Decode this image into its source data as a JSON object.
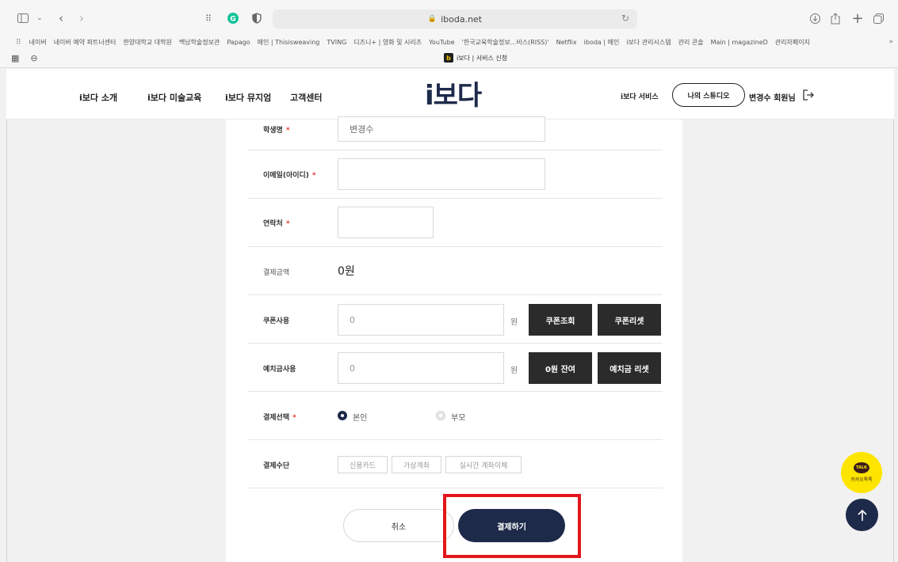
{
  "browser": {
    "url": "iboda.net",
    "bookmarks": [
      "네이버",
      "네이버 예약 파트너센터",
      "한양대학교 대학원",
      "백남학술정보관",
      "Papago",
      "메인 | Thisisweaving",
      "TVING",
      "디즈니+ | 영화 및 시리즈",
      "YouTube",
      "'한국교육학술정보...비스(RISS)'",
      "Netflix",
      "iboda | 메인",
      "i보다 관리시스템",
      "관리 콘솔",
      "Main | magazineD",
      "관리자페이지"
    ],
    "tab_title": "i보다 | 서비스 신청"
  },
  "header": {
    "nav": [
      "i보다 소개",
      "i보다 미술교육",
      "i보다 뮤지엄",
      "고객센터"
    ],
    "logo": "i보다",
    "service_link": "i보다 서비스",
    "studio_button": "나의 스튜디오",
    "member_name": "변경수 회원님"
  },
  "form": {
    "student_name": {
      "label": "학생명",
      "value": "변경수"
    },
    "email": {
      "label": "이메일(아이디)",
      "value": ""
    },
    "contact": {
      "label": "연락처",
      "value": ""
    },
    "amount": {
      "label": "결제금액",
      "value": "0원"
    },
    "coupon": {
      "label": "쿠폰사용",
      "value": "0",
      "unit": "원",
      "lookup_button": "쿠폰조회",
      "reset_button": "쿠폰리셋"
    },
    "deposit": {
      "label": "예치금사용",
      "value": "0",
      "unit": "원",
      "balance_button": "0원 잔여",
      "reset_button": "예치금 리셋"
    },
    "payer": {
      "label": "결제선택",
      "options": [
        "본인",
        "부모"
      ],
      "selected": "본인"
    },
    "method": {
      "label": "결제수단",
      "options": [
        "신용카드",
        "가상계좌",
        "실시간 계좌이체"
      ]
    },
    "required_mark": "*"
  },
  "actions": {
    "cancel": "취소",
    "pay": "결제하기"
  },
  "floating": {
    "kakao_badge": "TALK",
    "kakao_label": "카카오톡톡"
  },
  "colors": {
    "brand_navy": "#1e2a4a",
    "highlight_red": "#e3151a",
    "kakao_yellow": "#fde500"
  }
}
